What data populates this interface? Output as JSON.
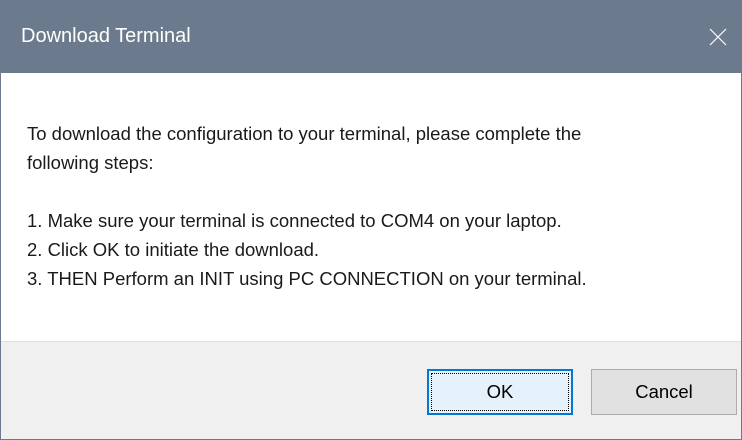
{
  "window": {
    "title": "Download Terminal",
    "close_icon": "close-icon"
  },
  "message": {
    "intro_line1": "To download the configuration to your terminal, please complete the",
    "intro_line2": "following steps:",
    "steps": [
      "1. Make sure your terminal is connected to COM4 on your laptop.",
      "2. Click OK to initiate the download.",
      "3. THEN Perform an INIT using PC CONNECTION on your terminal."
    ]
  },
  "buttons": {
    "ok_label": "OK",
    "cancel_label": "Cancel"
  },
  "colors": {
    "titlebar": "#6b7a8c",
    "footer": "#f0f0f0",
    "default_button_border": "#0078d7"
  }
}
